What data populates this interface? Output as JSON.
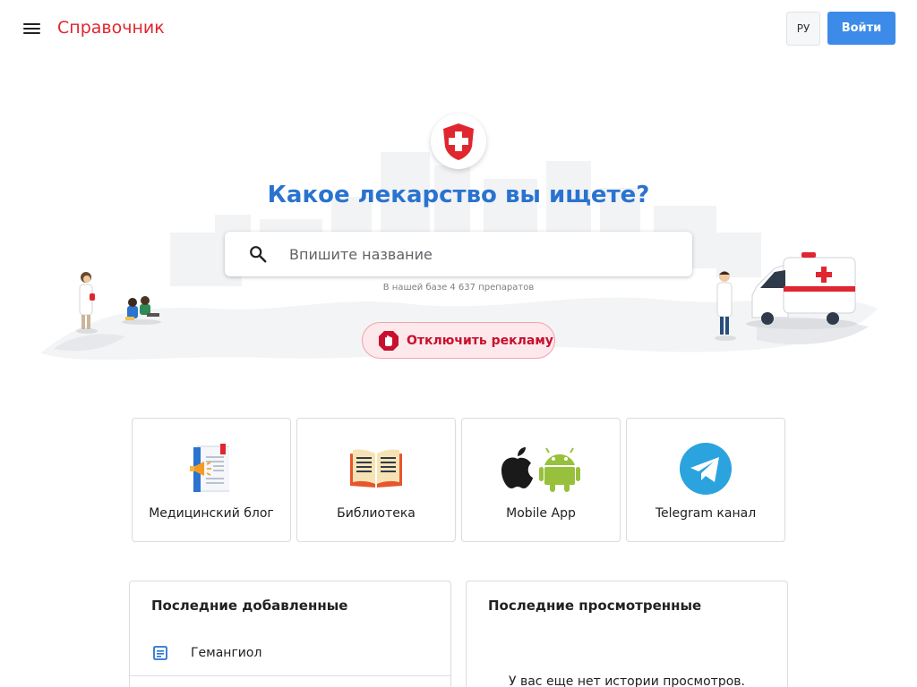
{
  "header": {
    "brand": "Справочник",
    "lang": "РУ",
    "login": "Войти"
  },
  "hero": {
    "title": "Какое лекарство вы ищете?",
    "search_placeholder": "Впишите название",
    "db_count": "В нашей базе 4 637 препаратов",
    "adblock_label": "Отключить рекламу"
  },
  "cards": [
    {
      "label": "Медицинский блог",
      "icon": "blog-icon"
    },
    {
      "label": "Библиотека",
      "icon": "book-icon"
    },
    {
      "label": "Mobile App",
      "icon": "apple-android-icon"
    },
    {
      "label": "Telegram канал",
      "icon": "telegram-icon"
    }
  ],
  "recent_added": {
    "title": "Последние добавленные",
    "items": [
      "Гемангиол"
    ]
  },
  "recent_viewed": {
    "title": "Последние просмотренные",
    "empty": "У вас еще нет истории просмотров."
  },
  "colors": {
    "brand": "#e0262f",
    "accent": "#3d8be8",
    "title": "#2a73cf"
  }
}
